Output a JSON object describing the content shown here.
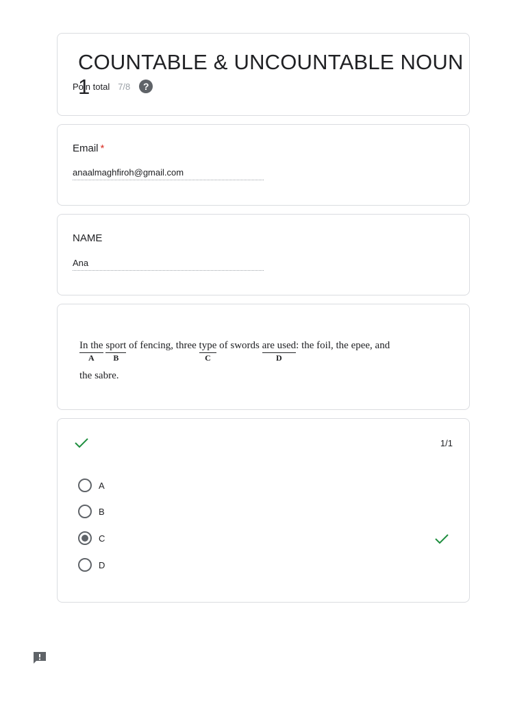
{
  "header": {
    "title": "COUNTABLE & UNCOUNTABLE NOUN 1",
    "points_label": "Poin total",
    "points_value": "7/8",
    "help_icon": "help-icon",
    "help_glyph": "?"
  },
  "email_question": {
    "label": "Email",
    "required_marker": "*",
    "answer": "anaalmaghfiroh@gmail.com"
  },
  "name_question": {
    "label": "NAME",
    "answer": "Ana"
  },
  "question_image": {
    "segments": [
      {
        "text": "In the",
        "letter": "A"
      },
      {
        "text": " "
      },
      {
        "text": "sport",
        "letter": "B"
      },
      {
        "text": " of fencing, three "
      },
      {
        "text": "type",
        "letter": "C"
      },
      {
        "text": " of swords "
      },
      {
        "text": "are used",
        "letter": "D"
      },
      {
        "text": ": the foil, the epee, and"
      }
    ],
    "line2": "the sabre."
  },
  "options_question": {
    "correct_icon": "check-icon",
    "score": "1/1",
    "options": [
      {
        "label": "A",
        "selected": false
      },
      {
        "label": "B",
        "selected": false
      },
      {
        "label": "C",
        "selected": true
      },
      {
        "label": "D",
        "selected": false
      }
    ]
  },
  "colors": {
    "correct": "#1e8e3e",
    "required": "#d93025",
    "border": "#dadce0"
  },
  "feedback_icon": "report-feedback-icon"
}
